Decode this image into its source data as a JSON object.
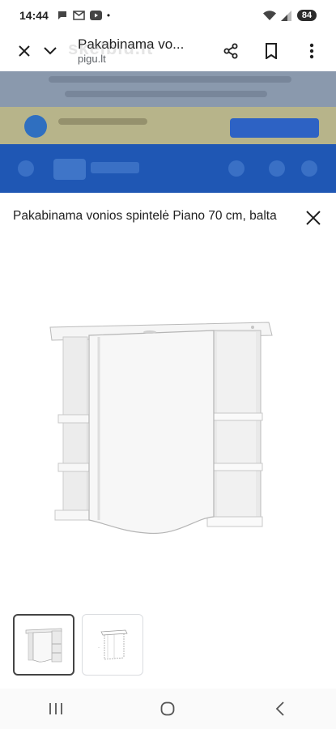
{
  "status_bar": {
    "time": "14:44",
    "battery": "84",
    "icons": [
      "chat-bubble-icon",
      "gmail-icon",
      "youtube-icon",
      "dot-icon",
      "wifi-icon",
      "signal-icon"
    ]
  },
  "toolbar": {
    "title": "Pakabinama vo...",
    "domain": "pigu.lt",
    "watermark": "skelbiu.lt",
    "icons": [
      "close-icon",
      "chevron-down-icon",
      "share-icon",
      "bookmark-icon",
      "more-vert-icon"
    ]
  },
  "sheet": {
    "title": "Pakabinama vonios spintelė Piano 70 cm, balta"
  },
  "thumbnails": [
    {
      "name": "product-photo",
      "selected": true
    },
    {
      "name": "product-drawing",
      "selected": false
    }
  ],
  "nav_bar": {
    "icons": [
      "recents-icon",
      "home-icon",
      "back-icon"
    ]
  }
}
